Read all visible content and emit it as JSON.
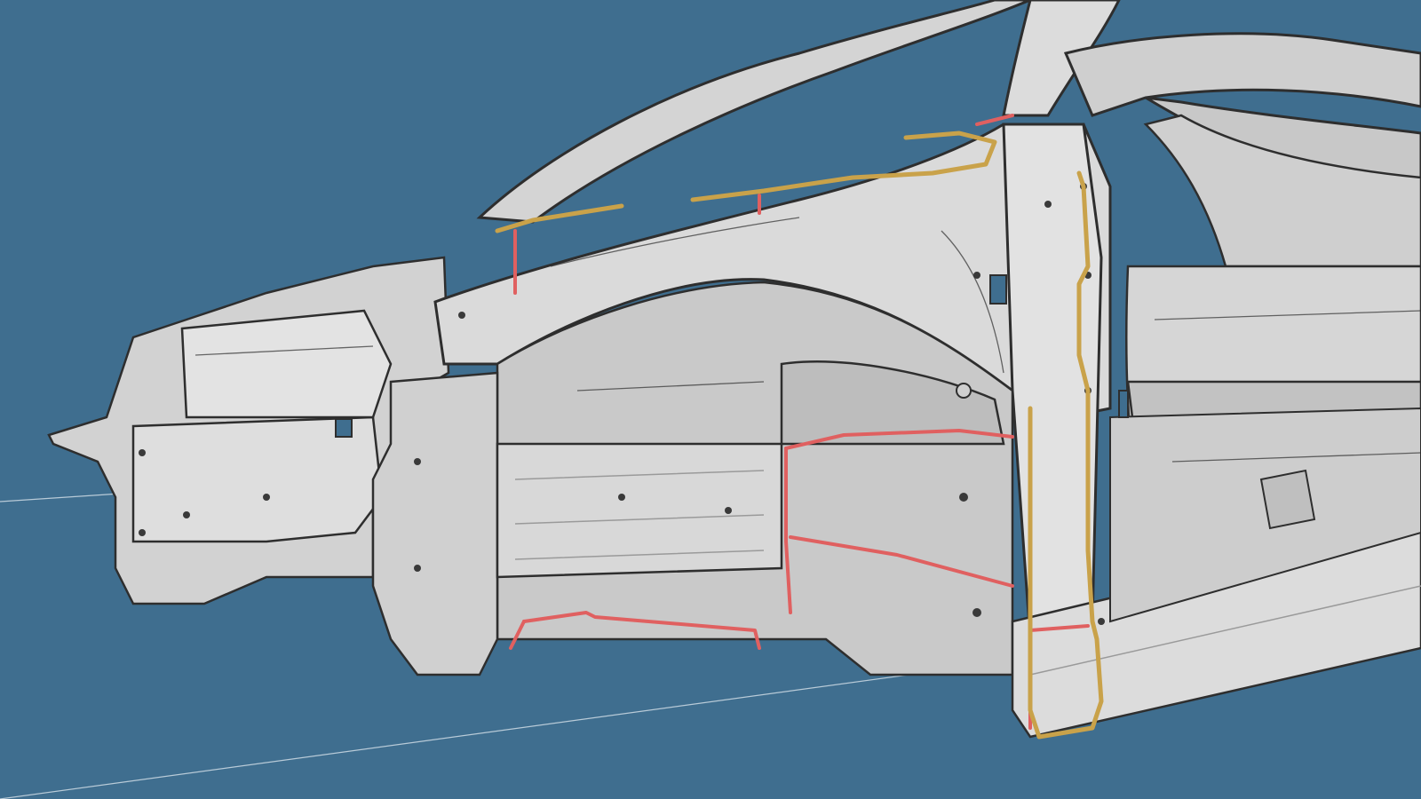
{
  "viewport": {
    "background_color": "#3f6e8f",
    "model": "car-body-in-white",
    "view": "front-left-three-quarter",
    "colors": {
      "panel": "#d9d9d9",
      "panel_light": "#e6e6e6",
      "panel_shadow": "#bdbdbd",
      "edge": "#2e2e2e",
      "seam_red": "#e06060",
      "seam_yellow": "#c9a24a",
      "ground_line": "#b9cbd8"
    }
  }
}
